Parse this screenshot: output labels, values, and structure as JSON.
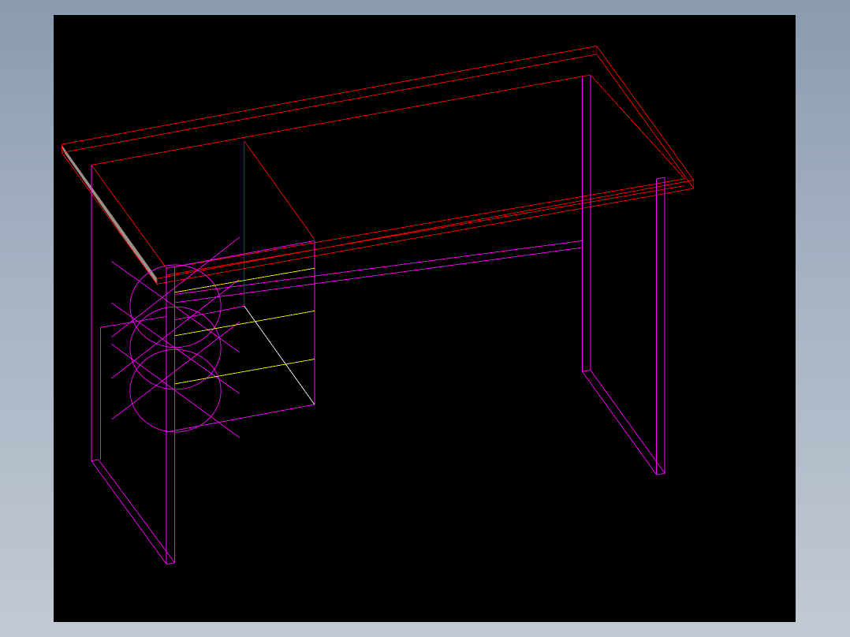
{
  "colors": {
    "background": "#000000",
    "frame": "#ff00ff",
    "top": "#ff0000",
    "drawer_line": "#ffff00",
    "hidden_edge": "#ffffff",
    "edge_band": "#9a8f86"
  },
  "layers": [
    "desktop",
    "frame",
    "drawer-box",
    "drawer-lines",
    "handles"
  ]
}
